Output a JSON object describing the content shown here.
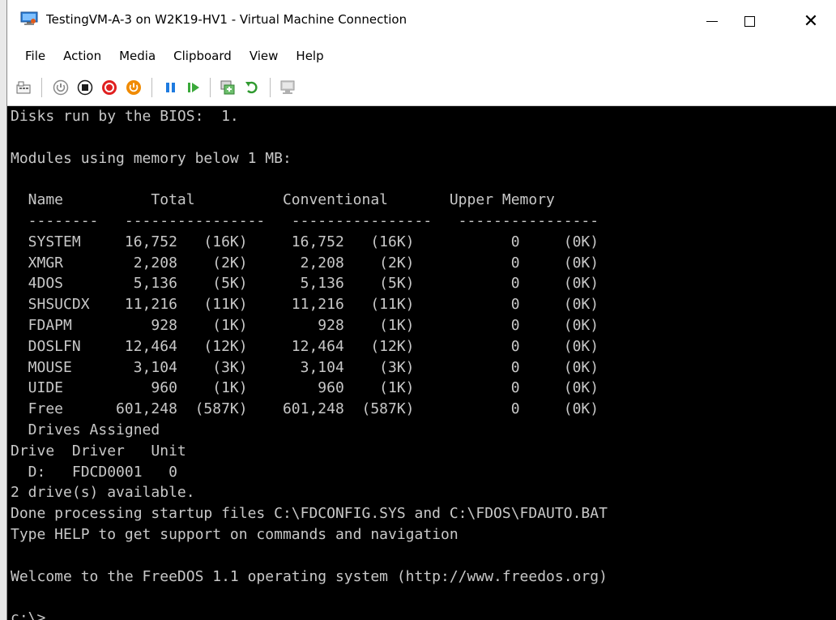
{
  "window": {
    "title": "TestingVM-A-3 on W2K19-HV1 - Virtual Machine Connection",
    "controls": {
      "minimize": "—",
      "close": "✕"
    }
  },
  "menu": [
    "File",
    "Action",
    "Media",
    "Clipboard",
    "View",
    "Help"
  ],
  "toolbar": {
    "buttons": [
      "ctrl-alt-del-icon",
      "start-icon",
      "turn-off-icon",
      "shut-down-icon",
      "power-icon",
      "pause-icon",
      "resume-icon",
      "checkpoint-icon",
      "revert-icon",
      "enhanced-session-icon"
    ],
    "colors": {
      "red": "#e02020",
      "orange": "#f08a00",
      "blue": "#1e7be0",
      "green": "#3aa93a"
    }
  },
  "console": {
    "fg": "#c8c8c8",
    "bg": "#000000",
    "lines": [
      "Disks run by the BIOS:  1.",
      "",
      "Modules using memory below 1 MB:",
      "",
      "  Name          Total          Conventional       Upper Memory",
      "  --------   ----------------   ----------------   ----------------",
      "  SYSTEM     16,752   (16K)     16,752   (16K)           0     (0K)",
      "  XMGR        2,208    (2K)      2,208    (2K)           0     (0K)",
      "  4DOS        5,136    (5K)      5,136    (5K)           0     (0K)",
      "  SHSUCDX    11,216   (11K)     11,216   (11K)           0     (0K)",
      "  FDAPM         928    (1K)        928    (1K)           0     (0K)",
      "  DOSLFN     12,464   (12K)     12,464   (12K)           0     (0K)",
      "  MOUSE       3,104    (3K)      3,104    (3K)           0     (0K)",
      "  UIDE          960    (1K)        960    (1K)           0     (0K)",
      "  Free      601,248  (587K)    601,248  (587K)           0     (0K)",
      "  Drives Assigned",
      "Drive  Driver   Unit",
      "  D:   FDCD0001   0",
      "2 drive(s) available.",
      "Done processing startup files C:\\FDCONFIG.SYS and C:\\FDOS\\FDAUTO.BAT",
      "Type HELP to get support on commands and navigation",
      "",
      "Welcome to the FreeDOS 1.1 operating system (http://www.freedos.org)",
      "",
      "c:\\>"
    ]
  }
}
